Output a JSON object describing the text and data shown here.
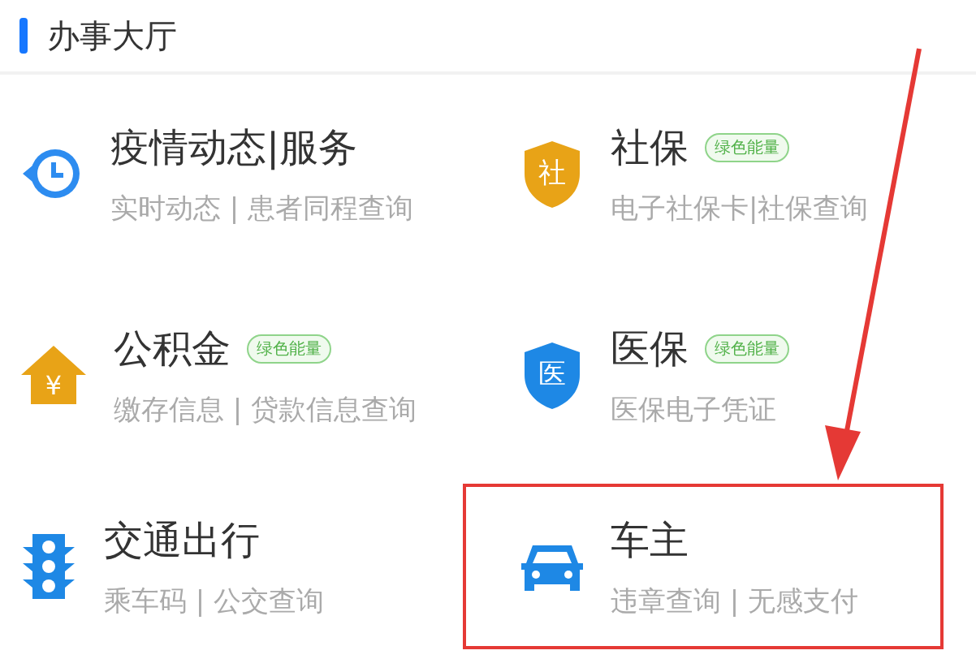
{
  "section": {
    "title": "办事大厅"
  },
  "services": [
    {
      "kind": "clock",
      "title": "疫情动态|服务",
      "subtitle": "实时动态 | 患者同程查询",
      "highlighted": false
    },
    {
      "kind": "shield-gold",
      "icon_label": "社",
      "title": "社保",
      "badge": "绿色能量",
      "subtitle": "电子社保卡|社保查询",
      "highlighted": false
    },
    {
      "kind": "house",
      "icon_label": "¥",
      "title": "公积金",
      "badge": "绿色能量",
      "subtitle": "缴存信息 | 贷款信息查询",
      "highlighted": false
    },
    {
      "kind": "shield-blue",
      "icon_label": "医",
      "title": "医保",
      "badge": "绿色能量",
      "subtitle": "医保电子凭证",
      "highlighted": false
    },
    {
      "kind": "traffic",
      "title": "交通出行",
      "subtitle": "乘车码 | 公交查询",
      "highlighted": false
    },
    {
      "kind": "car",
      "title": "车主",
      "subtitle": "违章查询 | 无感支付",
      "highlighted": true
    }
  ],
  "annotation": {
    "arrow": true
  }
}
